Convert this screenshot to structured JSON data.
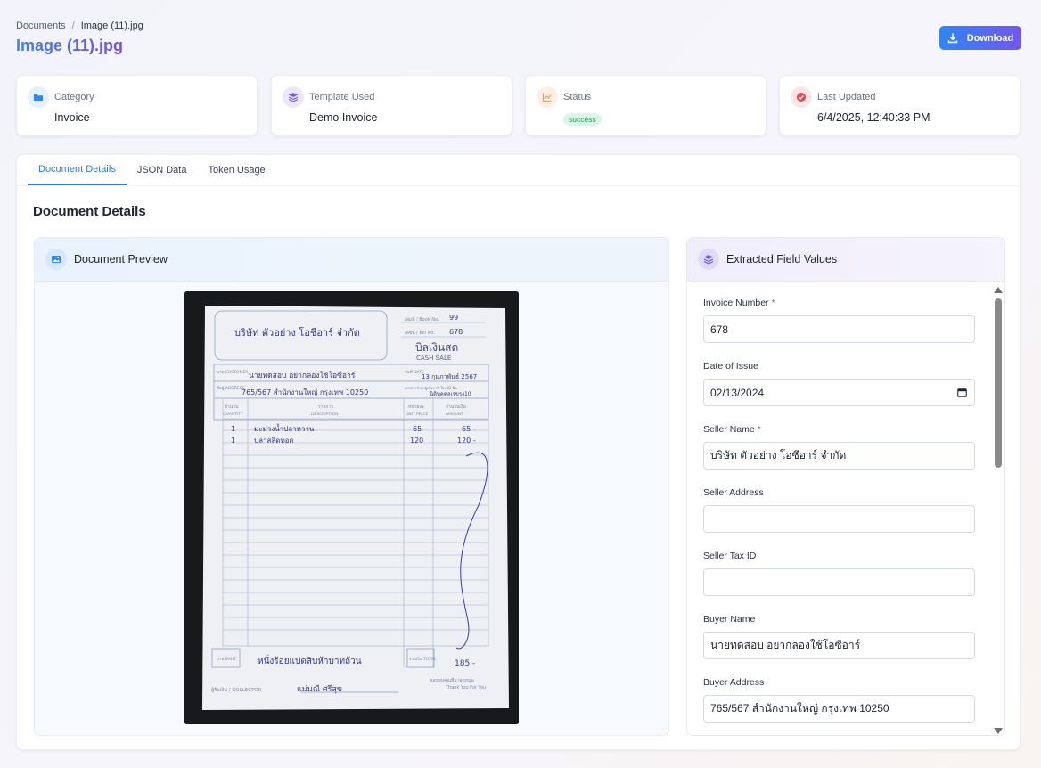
{
  "breadcrumb": {
    "root": "Documents",
    "separator": "/",
    "current": "Image (11).jpg"
  },
  "page_title": "Image (11).jpg",
  "download_label": "Download",
  "cards": [
    {
      "label": "Category",
      "value": "Invoice",
      "icon": "folder-icon",
      "color": "#2f86f5"
    },
    {
      "label": "Template Used",
      "value": "Demo Invoice",
      "icon": "layers-icon",
      "color": "#7356ee"
    },
    {
      "label": "Status",
      "value": "success",
      "icon": "chart-line-icon",
      "color": "#f59e42"
    },
    {
      "label": "Last Updated",
      "value": "6/4/2025, 12:40:33 PM",
      "icon": "check-circle-icon",
      "color": "#e5484d"
    }
  ],
  "tabs": [
    "Document Details",
    "JSON Data",
    "Token Usage"
  ],
  "active_tab": "Document Details",
  "section_title": "Document Details",
  "preview": {
    "title": "Document Preview",
    "icon": "image-icon"
  },
  "receipt": {
    "company": "บริษัท ตัวอย่าง โอชีอาร์ จำกัด",
    "book_no_label": "เล่มที่ / Book No.",
    "book_no": "99",
    "no_label": "เลขที่ / Bill No.",
    "no": "678",
    "doc_title_th": "บิลเงินสด",
    "doc_title_en": "CASH SALE",
    "customer_label": "นาม CUSTOMER",
    "customer": "นายทดสอบ อยากลองใช้โอซีอาร์",
    "date_label": "วันที่ DATE",
    "date": "13 กุมภาพันธ์ 2567",
    "address_label": "ที่อยู่ ADDRESS",
    "address": "765/567 สำนักงานใหญ่ กรุงเทพ 10250",
    "tax_label": "เลขประจำตัวผู้เสียภาษี Tax ID No.",
    "tax_id": "นิติบุคคลเรขรง10",
    "col_qty_th": "จำนวน",
    "col_qty": "QUANTITY",
    "col_desc_th": "รายการ",
    "col_desc": "DESCRIPTION",
    "col_unit_th": "หน่วยละ",
    "col_unit": "UNIT PRICE",
    "col_amt_th": "จำนวนเงิน",
    "col_amt": "AMOUNT",
    "items": [
      {
        "qty": "1",
        "desc": "มะม่วงน้ำปลาหวาน",
        "unit": "65",
        "amt": "65 -"
      },
      {
        "qty": "1",
        "desc": "ปลาสลิดทอด",
        "unit": "120",
        "amt": "120 -"
      }
    ],
    "baht_label": "บาท BAHT",
    "amount_words": "หนึ่งร้อยแปดสิบห้าบาทถ้วน",
    "total_label": "รวมเงิน TOTAL",
    "total": "185 -",
    "collector_label": "ผู้รับเงิน / COLLECTOR",
    "collector": "แม่มณี ศรีสุข",
    "thanks_th": "ขอขอบคุณที่มาอุดหนุน",
    "thanks_en": "Thank You For You"
  },
  "fields_panel": {
    "title": "Extracted Field Values",
    "icon": "layers-icon",
    "fields": [
      {
        "label": "Invoice Number",
        "required": "*",
        "value": "678"
      },
      {
        "label": "Date of Issue",
        "required": "",
        "value": "02/13/2024"
      },
      {
        "label": "Seller Name",
        "required": "*",
        "value": "บริษัท ตัวอย่าง โอซีอาร์ จำกัด"
      },
      {
        "label": "Seller Address",
        "required": "",
        "value": ""
      },
      {
        "label": "Seller Tax ID",
        "required": "",
        "value": ""
      },
      {
        "label": "Buyer Name",
        "required": "",
        "value": "นายทดสอบ อยากลองใช้โอซีอาร์"
      },
      {
        "label": "Buyer Address",
        "required": "",
        "value": "765/567 สำนักงานใหญ่ กรุงเทพ 10250"
      }
    ]
  }
}
